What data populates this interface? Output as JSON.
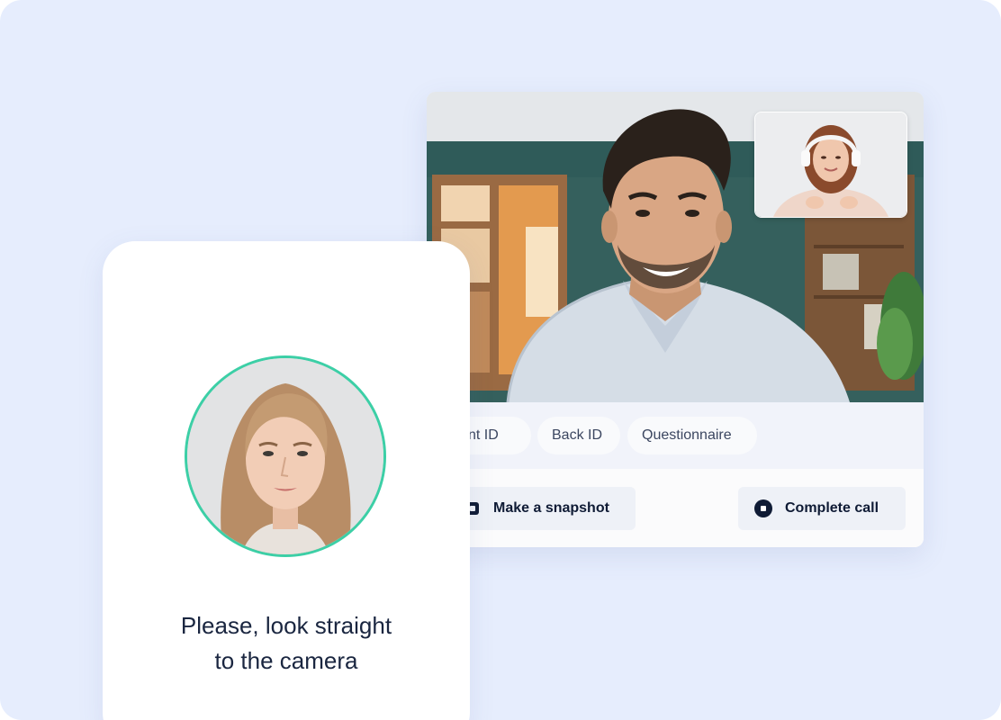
{
  "call": {
    "tabs": [
      {
        "label": "Front ID"
      },
      {
        "label": "Back ID"
      },
      {
        "label": "Questionnaire"
      }
    ],
    "actions": {
      "snapshot_label": "Make a snapshot",
      "complete_label": "Complete call"
    }
  },
  "phone": {
    "instruction": "Please, look straight\nto the camera"
  },
  "colors": {
    "background": "#e6edfd",
    "accent_ring": "#3ccfa6",
    "text_dark": "#0f1b35"
  },
  "icons": {
    "snapshot": "snapshot-icon",
    "complete": "stop-icon"
  }
}
